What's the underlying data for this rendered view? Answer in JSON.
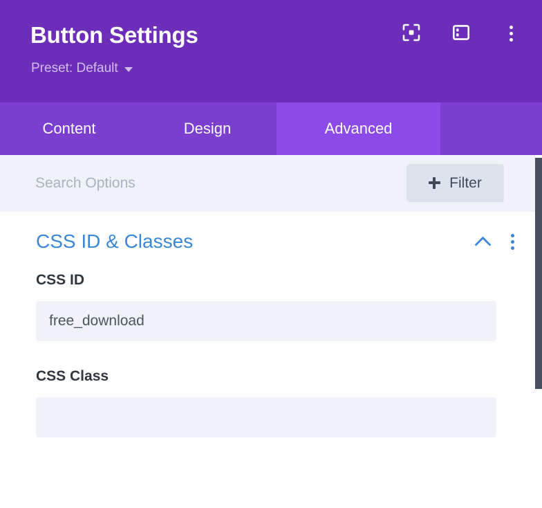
{
  "header": {
    "title": "Button Settings",
    "preset_label": "Preset: Default",
    "caret_icon": "caret-down-icon",
    "actions": [
      {
        "name": "focus-target-icon",
        "title": "Focus"
      },
      {
        "name": "panel-layout-icon",
        "title": "Layout"
      },
      {
        "name": "more-options-icon",
        "title": "More Options"
      }
    ]
  },
  "tabs": [
    {
      "label": "Content",
      "active": false
    },
    {
      "label": "Design",
      "active": false
    },
    {
      "label": "Advanced",
      "active": true
    }
  ],
  "search": {
    "placeholder": "Search Options",
    "value": "",
    "filter_label": "Filter",
    "filter_icon": "plus-icon"
  },
  "section": {
    "title": "CSS ID & Classes",
    "collapse_icon": "chevron-up-icon",
    "menu_icon": "more-options-icon",
    "fields": [
      {
        "label": "CSS ID",
        "value": "free_download",
        "placeholder": ""
      },
      {
        "label": "CSS Class",
        "value": "",
        "placeholder": ""
      }
    ]
  },
  "colors": {
    "header_purple": "#6c2eb9",
    "tabbar_purple": "#7b3fd0",
    "active_tab_purple": "#8c4ae8",
    "section_blue": "#3b87d5",
    "field_bg": "#eff2f8",
    "search_bg": "#eff2f7",
    "filter_bg": "#dde3ec",
    "scrollbar": "#47505f"
  }
}
